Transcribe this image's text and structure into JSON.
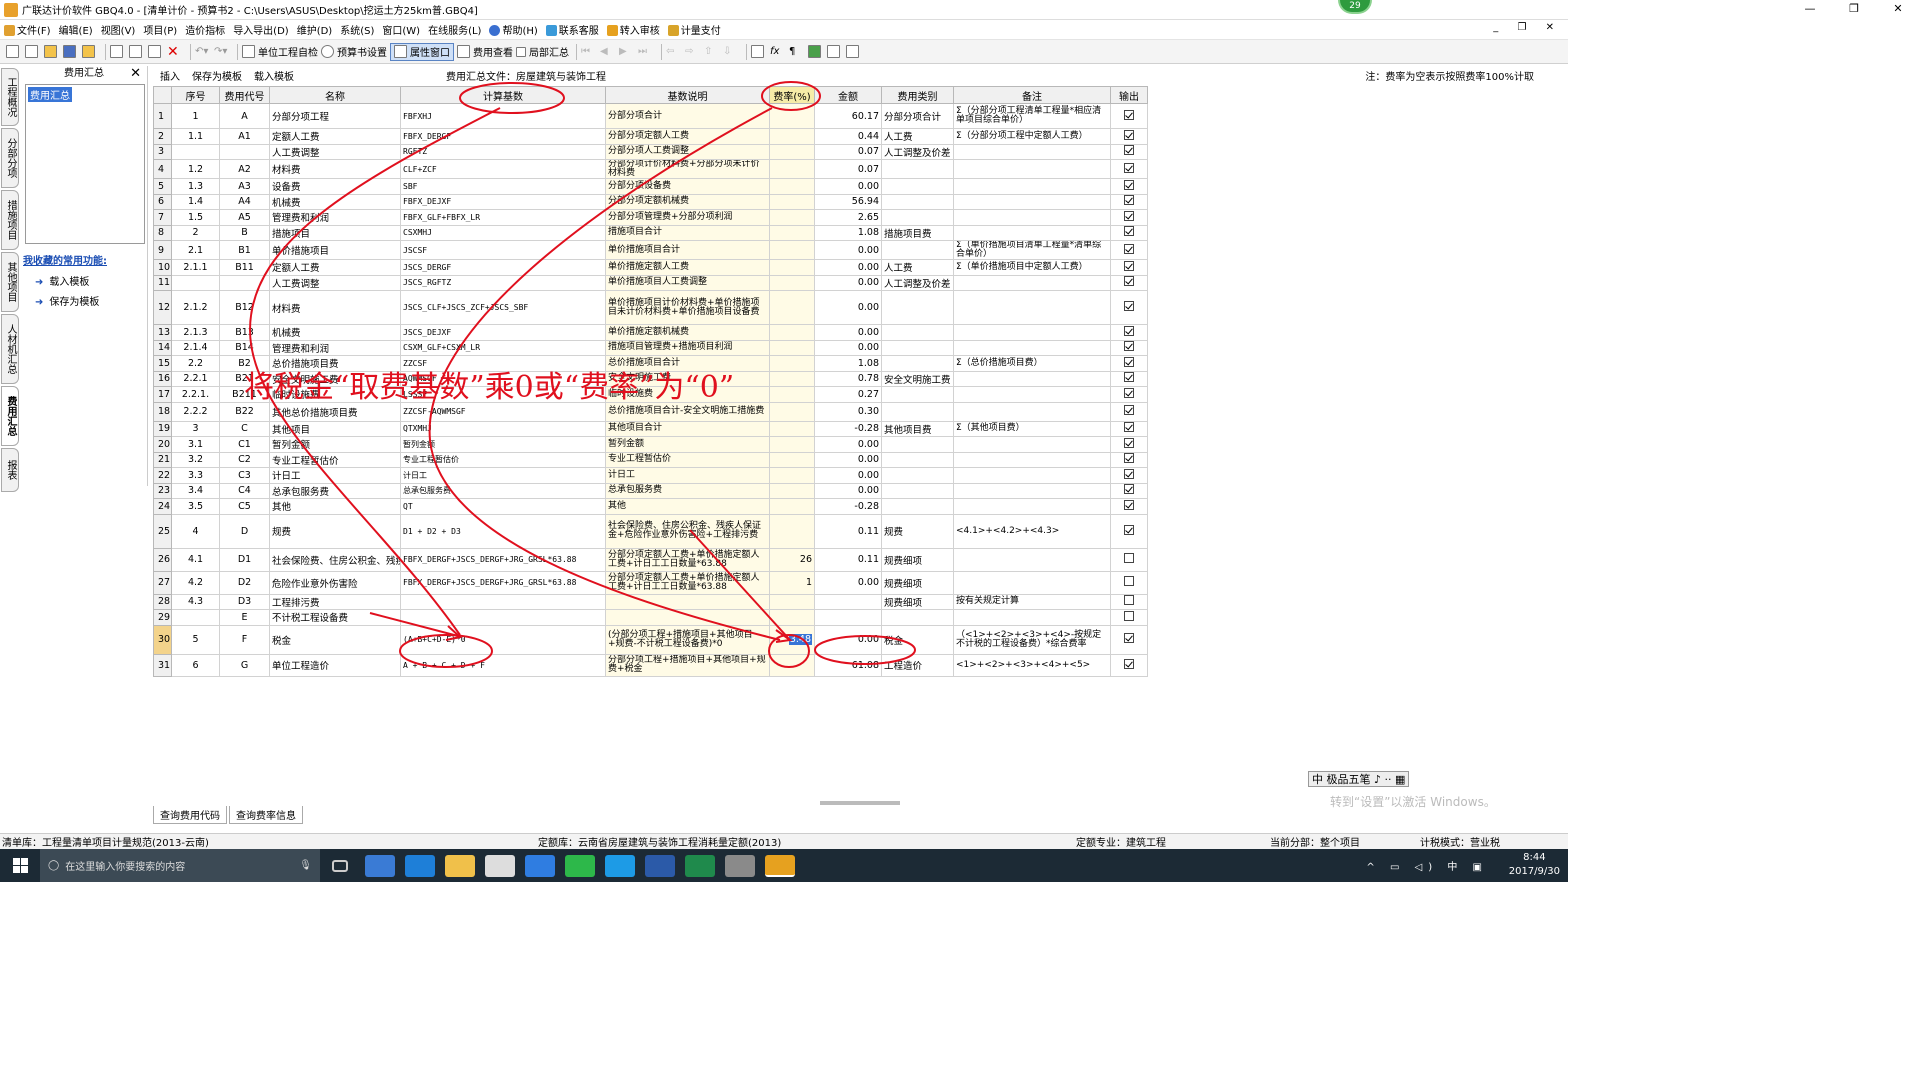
{
  "window": {
    "title": "广联达计价软件 GBQ4.0 - [清单计价 - 预算书2 - C:\\Users\\ASUS\\Desktop\\挖运土方25km普.GBQ4]",
    "badge": "29",
    "controls": [
      "—",
      "❐",
      "✕"
    ]
  },
  "menu": {
    "items": [
      "文件(F)",
      "编辑(E)",
      "视图(V)",
      "项目(P)",
      "造价指标",
      "导入导出(D)",
      "维护(D)",
      "系统(S)",
      "窗口(W)",
      "在线服务(L)",
      "帮助(H)",
      "联系客服",
      "转入审核",
      "计量支付"
    ],
    "right_controls": "_ ❐ ✕"
  },
  "toolbar": {
    "unit_check": "单位工程自检",
    "budget_settings": "预算书设置",
    "property_window": "属性窗口",
    "fee_view": "费用查看",
    "local_summary": "局部汇总"
  },
  "vertical_tabs": [
    "工程概况",
    "分部分项",
    "措施项目",
    "其他项目",
    "人材机汇总",
    "费用汇总",
    "报表"
  ],
  "left_panel": {
    "title": "费用汇总",
    "tree_node": "费用汇总",
    "favorites_title": "我收藏的常用功能:",
    "favorites": [
      "载入模板",
      "保存为模板"
    ]
  },
  "subbar": {
    "insert": "插入",
    "save_template": "保存为模板",
    "load_template": "载入模板",
    "file_label": "费用汇总文件：房屋建筑与装饰工程",
    "note": "注：费率为空表示按照费率100%计取"
  },
  "columns": [
    "",
    "序号",
    "费用代号",
    "名称",
    "计算基数",
    "基数说明",
    "费率(%)",
    "金额",
    "费用类别",
    "备注",
    "输出"
  ],
  "rows": [
    [
      "1",
      "1",
      "A",
      "分部分项工程",
      "FBFXHJ",
      "分部分项合计",
      "",
      "60.17",
      "分部分项合计",
      "Σ（分部分项工程清单工程量*相应清单项目综合单价）",
      true
    ],
    [
      "2",
      "1.1",
      "A1",
      "定额人工费",
      "FBFX_DERGF",
      "分部分项定额人工费",
      "",
      "0.44",
      "人工费",
      "Σ（分部分项工程中定额人工费）",
      true
    ],
    [
      "3",
      "",
      "",
      "人工费调整",
      "RGFTZ",
      "分部分项人工费调整",
      "",
      "0.07",
      "人工调整及价差",
      "",
      true
    ],
    [
      "4",
      "1.2",
      "A2",
      "材料费",
      "CLF+ZCF",
      "分部分项计价材料费+分部分项未计价材料费",
      "",
      "0.07",
      "",
      "",
      true
    ],
    [
      "5",
      "1.3",
      "A3",
      "设备费",
      "SBF",
      "分部分项设备费",
      "",
      "0.00",
      "",
      "",
      true
    ],
    [
      "6",
      "1.4",
      "A4",
      "机械费",
      "FBFX_DEJXF",
      "分部分项定额机械费",
      "",
      "56.94",
      "",
      "",
      true
    ],
    [
      "7",
      "1.5",
      "A5",
      "管理费和利润",
      "FBFX_GLF+FBFX_LR",
      "分部分项管理费+分部分项利润",
      "",
      "2.65",
      "",
      "",
      true
    ],
    [
      "8",
      "2",
      "B",
      "措施项目",
      "CSXMHJ",
      "措施项目合计",
      "",
      "1.08",
      "措施项目费",
      "",
      true
    ],
    [
      "9",
      "2.1",
      "B1",
      "单价措施项目",
      "JSCSF",
      "单价措施项目合计",
      "",
      "0.00",
      "",
      "Σ（单价措施项目清单工程量*清单综合单价）",
      true
    ],
    [
      "10",
      "2.1.1",
      "B11",
      "定额人工费",
      "JSCS_DERGF",
      "单价措施定额人工费",
      "",
      "0.00",
      "人工费",
      "Σ（单价措施项目中定额人工费）",
      true
    ],
    [
      "11",
      "",
      "",
      "人工费调整",
      "JSCS_RGFTZ",
      "单价措施项目人工费调整",
      "",
      "0.00",
      "人工调整及价差",
      "",
      true
    ],
    [
      "12",
      "2.1.2",
      "B12",
      "材料费",
      "JSCS_CLF+JSCS_ZCF+JSCS_SBF",
      "单价措施项目计价材料费+单价措施项目未计价材料费+单价措施项目设备费",
      "",
      "0.00",
      "",
      "",
      true
    ],
    [
      "13",
      "2.1.3",
      "B13",
      "机械费",
      "JSCS_DEJXF",
      "单价措施定额机械费",
      "",
      "0.00",
      "",
      "",
      true
    ],
    [
      "14",
      "2.1.4",
      "B14",
      "管理费和利润",
      "CSXM_GLF+CSXM_LR",
      "措施项目管理费+措施项目利润",
      "",
      "0.00",
      "",
      "",
      true
    ],
    [
      "15",
      "2.2",
      "B2",
      "总价措施项目费",
      "ZZCSF",
      "总价措施项目合计",
      "",
      "1.08",
      "",
      "Σ（总价措施项目费）",
      true
    ],
    [
      "16",
      "2.2.1",
      "B21",
      "安全文明施工费",
      "AQWMSGF",
      "安全文明施工费",
      "",
      "0.78",
      "安全文明施工费",
      "",
      true
    ],
    [
      "17",
      "2.2.1.",
      "B211",
      "临时设施费",
      "LSSSF",
      "临时设施费",
      "",
      "0.27",
      "",
      "",
      true
    ],
    [
      "18",
      "2.2.2",
      "B22",
      "其他总价措施项目费",
      "ZZCSF-AQWMSGF",
      "总价措施项目合计-安全文明施工措施费",
      "",
      "0.30",
      "",
      "",
      true
    ],
    [
      "19",
      "3",
      "C",
      "其他项目",
      "QTXMHJ",
      "其他项目合计",
      "",
      "-0.28",
      "其他项目费",
      "Σ（其他项目费）",
      true
    ],
    [
      "20",
      "3.1",
      "C1",
      "暂列金额",
      "暂列金额",
      "暂列金额",
      "",
      "0.00",
      "",
      "",
      true
    ],
    [
      "21",
      "3.2",
      "C2",
      "专业工程暂估价",
      "专业工程暂估价",
      "专业工程暂估价",
      "",
      "0.00",
      "",
      "",
      true
    ],
    [
      "22",
      "3.3",
      "C3",
      "计日工",
      "计日工",
      "计日工",
      "",
      "0.00",
      "",
      "",
      true
    ],
    [
      "23",
      "3.4",
      "C4",
      "总承包服务费",
      "总承包服务费",
      "总承包服务费",
      "",
      "0.00",
      "",
      "",
      true
    ],
    [
      "24",
      "3.5",
      "C5",
      "其他",
      "QT",
      "其他",
      "",
      "-0.28",
      "",
      "",
      true
    ],
    [
      "25",
      "4",
      "D",
      "规费",
      "D1 + D2 + D3",
      "社会保险费、住房公积金、残疾人保证金+危险作业意外伤害险+工程排污费",
      "",
      "0.11",
      "规费",
      "<4.1>+<4.2>+<4.3>",
      true
    ],
    [
      "26",
      "4.1",
      "D1",
      "社会保险费、住房公积金、残疾人保证金",
      "FBFX_DERGF+JSCS_DERGF+JRG_GRSL*63.88",
      "分部分项定额人工费+单价措施定额人工费+计日工工日数量*63.88",
      "26",
      "0.11",
      "规费细项",
      "",
      false
    ],
    [
      "27",
      "4.2",
      "D2",
      "危险作业意外伤害险",
      "FBFX_DERGF+JSCS_DERGF+JRG_GRSL*63.88",
      "分部分项定额人工费+单价措施定额人工费+计日工工日数量*63.88",
      "1",
      "0.00",
      "规费细项",
      "",
      false
    ],
    [
      "28",
      "4.3",
      "D3",
      "工程排污费",
      "",
      "",
      "",
      "",
      "规费细项",
      "按有关规定计算",
      false
    ],
    [
      "29",
      "",
      "E",
      "不计税工程设备费",
      "",
      "",
      "",
      "",
      "",
      "",
      false
    ],
    [
      "30",
      "5",
      "F",
      "税金",
      "(A+B+C+D-E)*0",
      "(分部分项工程+措施项目+其他项目+规费-不计税工程设备费)*0",
      "3.48",
      "0.00",
      "税金",
      "（<1>+<2>+<3>+<4>-按规定不计税的工程设备费）*综合费率",
      true
    ],
    [
      "31",
      "6",
      "G",
      "单位工程造价",
      "A + B + C + D + F",
      "分部分项工程+措施项目+其他项目+规费+税金",
      "",
      "61.08",
      "工程造价",
      "<1>+<2>+<3>+<4>+<5>",
      true
    ]
  ],
  "annotation": {
    "text": "将税金“取费基数”乘0或“费率”为“0”",
    "color": "#e0101e"
  },
  "bottom_tabs": [
    "查询费用代码",
    "查询费率信息"
  ],
  "ime": "中 极品五笔 ♪ ·· ▦",
  "activate_watermark": "转到“设置”以激活 Windows。",
  "status": {
    "qd_lib": "清单库：工程量清单项目计量规范(2013-云南)",
    "de_lib": "定额库：云南省房屋建筑与装饰工程消耗量定额(2013)",
    "de_major": "定额专业：建筑工程",
    "current": "当前分部：整个项目",
    "tax": "计税模式：营业税"
  },
  "taskbar": {
    "search_placeholder": "在这里输入你要搜索的内容",
    "time": "8:44",
    "date": "2017/9/30",
    "tray_text": "^ ▭ ◁) 中 ▣"
  }
}
